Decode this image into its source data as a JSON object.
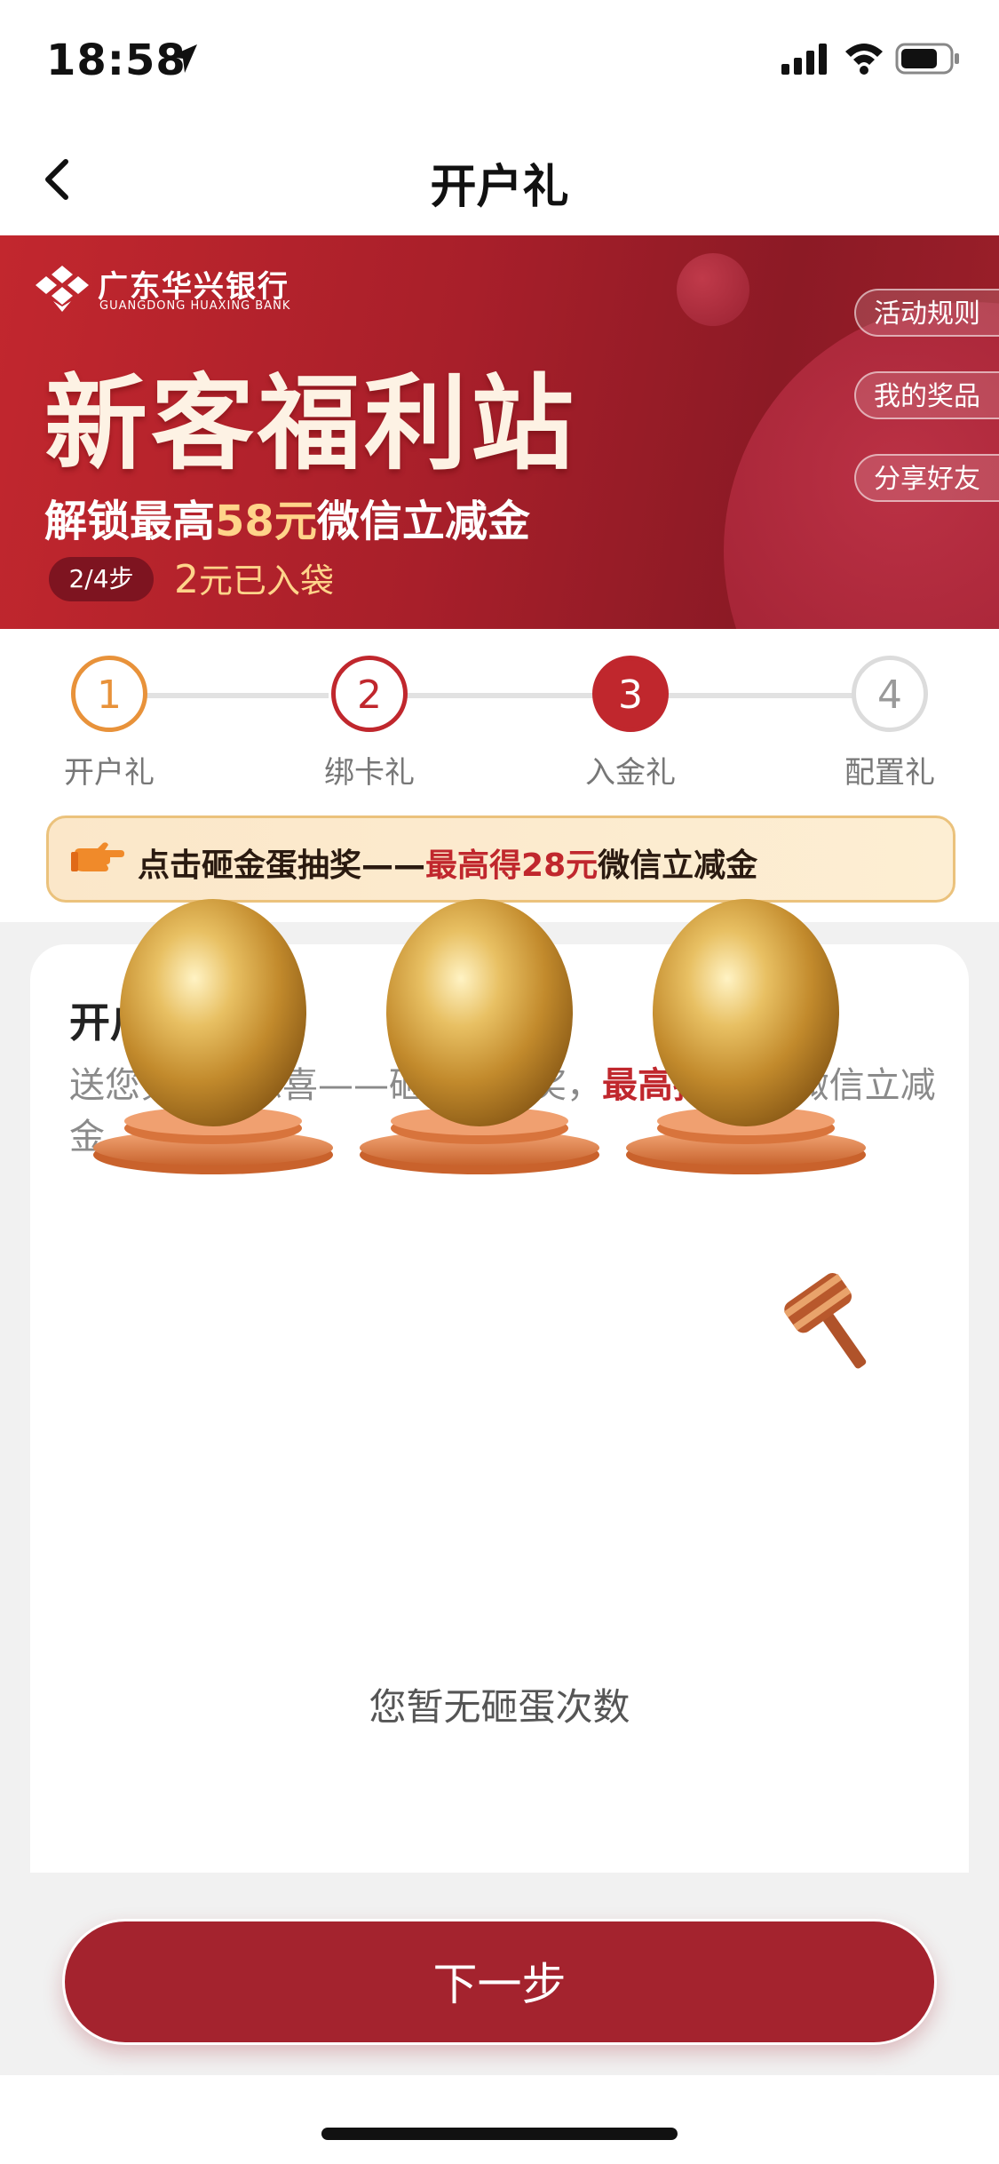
{
  "status_bar": {
    "time": "18:58"
  },
  "nav": {
    "title": "开户礼"
  },
  "banner": {
    "bank_name_cn": "广东华兴银行",
    "bank_name_en": "GUANGDONG HUAXING BANK",
    "title": "新客福利站",
    "subtitle_pre": "解锁最高",
    "subtitle_amount": "58元",
    "subtitle_post": "微信立减金",
    "step_pill": "2/4步",
    "got_amount": "2",
    "got_text": "元已入袋",
    "side_buttons": [
      "活动规则",
      "我的奖品",
      "分享好友"
    ]
  },
  "steps": [
    {
      "number": "1",
      "label": "开户礼",
      "state": "done-orange"
    },
    {
      "number": "2",
      "label": "绑卡礼",
      "state": "done-red"
    },
    {
      "number": "3",
      "label": "入金礼",
      "state": "current"
    },
    {
      "number": "4",
      "label": "配置礼",
      "state": "pending"
    }
  ],
  "tip": {
    "icon": "pointing-hand-icon",
    "pre": "点击砸金蛋抽奖——",
    "highlight": "最高得28元",
    "post": "微信立减金"
  },
  "card": {
    "title": "开户砸金蛋",
    "desc_pre": "送您第一份惊喜——砸金蛋抽奖，",
    "desc_highlight": "最高抽28元",
    "desc_post": "微信立减金。",
    "eggs": [
      "golden-egg-1",
      "golden-egg-2",
      "golden-egg-3"
    ],
    "hammer_icon": "hammer-icon",
    "status": "您暂无砸蛋次数"
  },
  "next_button": "下一步",
  "colors": {
    "brand_red": "#a4232e",
    "banner_red": "#c2272e",
    "step_orange": "#e8923a",
    "highlight_gold": "#ffd48a"
  }
}
